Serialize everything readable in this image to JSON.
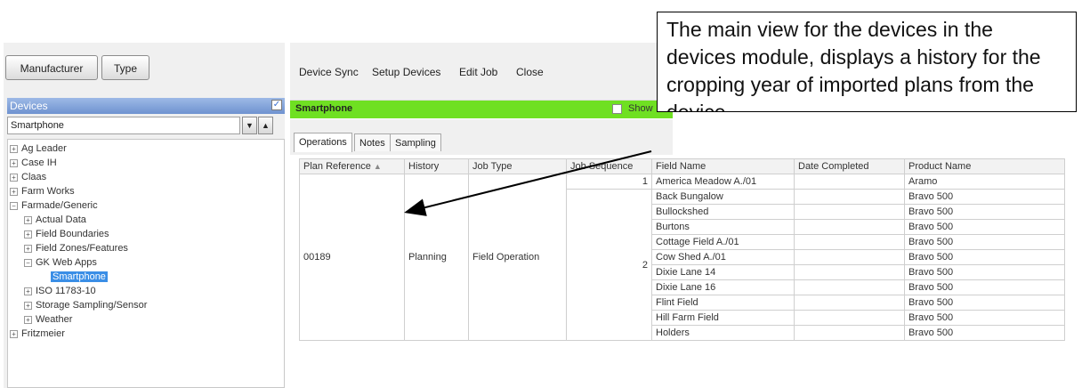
{
  "left_panel": {
    "tab_manufacturer": "Manufacturer",
    "tab_type": "Type",
    "devices_header": "Devices",
    "device_select_value": "Smartphone",
    "tree": [
      {
        "label": "Ag Leader",
        "exp": "+"
      },
      {
        "label": "Case IH",
        "exp": "+"
      },
      {
        "label": "Claas",
        "exp": "+"
      },
      {
        "label": "Farm Works",
        "exp": "+"
      },
      {
        "label": "Farmade/Generic",
        "exp": "−"
      },
      {
        "label": "Actual Data",
        "exp": "+"
      },
      {
        "label": "Field Boundaries",
        "exp": "+"
      },
      {
        "label": "Field Zones/Features",
        "exp": "+"
      },
      {
        "label": "GK Web Apps",
        "exp": "−"
      },
      {
        "label": "Smartphone",
        "exp": ""
      },
      {
        "label": "ISO 11783-10",
        "exp": "+"
      },
      {
        "label": "Storage Sampling/Sensor",
        "exp": "+"
      },
      {
        "label": "Weather",
        "exp": "+"
      },
      {
        "label": "Fritzmeier",
        "exp": "+"
      }
    ]
  },
  "toolbar": {
    "device_sync": "Device Sync",
    "setup_devices": "Setup Devices",
    "edit_job": "Edit Job",
    "close": "Close"
  },
  "panel": {
    "title": "Smartphone",
    "show_label": "Show",
    "tabs": [
      "Operations",
      "Notes",
      "Sampling"
    ]
  },
  "table": {
    "headers": [
      "Plan Reference",
      "History",
      "Job Type",
      "Job Sequence",
      "Field Name",
      "Date Completed",
      "Product Name"
    ],
    "plan_reference": "00189",
    "history": "Planning",
    "job_type": "Field Operation",
    "seq1": "1",
    "seq2": "2",
    "rows": [
      {
        "field": "America Meadow A./01",
        "date": "",
        "product": "Aramo"
      },
      {
        "field": "Back Bungalow",
        "date": "",
        "product": "Bravo 500"
      },
      {
        "field": "Bullockshed",
        "date": "",
        "product": "Bravo 500"
      },
      {
        "field": "Burtons",
        "date": "",
        "product": "Bravo 500"
      },
      {
        "field": "Cottage Field A./01",
        "date": "",
        "product": "Bravo 500"
      },
      {
        "field": "Cow Shed A./01",
        "date": "",
        "product": "Bravo 500"
      },
      {
        "field": "Dixie Lane 14",
        "date": "",
        "product": "Bravo 500"
      },
      {
        "field": "Dixie Lane 16",
        "date": "",
        "product": "Bravo 500"
      },
      {
        "field": "Flint Field",
        "date": "",
        "product": "Bravo 500"
      },
      {
        "field": "Hill Farm Field",
        "date": "",
        "product": "Bravo 500"
      },
      {
        "field": "Holders",
        "date": "",
        "product": "Bravo 500"
      }
    ]
  },
  "callout": {
    "text": "The main view for the devices in the devices module, displays a history for the cropping year of imported plans from the device"
  },
  "colors": {
    "panel_green": "#6fe022",
    "selection_blue": "#3a8ee6",
    "header_blue": "#6f93d0"
  }
}
